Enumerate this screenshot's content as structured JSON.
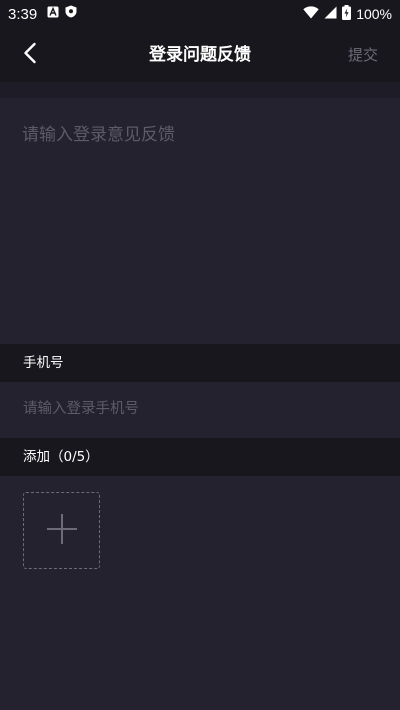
{
  "status_bar": {
    "time": "3:39",
    "left_icons": [
      "app-a-icon",
      "shield-icon"
    ],
    "battery_percent": "100%",
    "right_icons": [
      "wifi-icon",
      "signal-icon",
      "battery-charging-icon"
    ]
  },
  "nav": {
    "back_icon": "chevron-left-icon",
    "title": "登录问题反馈",
    "submit_label": "提交"
  },
  "feedback": {
    "placeholder": "请输入登录意见反馈",
    "value": ""
  },
  "phone": {
    "section_label": "手机号",
    "placeholder": "请输入登录手机号",
    "value": ""
  },
  "attachments": {
    "section_label": "添加（0/5）",
    "add_icon": "plus-icon"
  },
  "colors": {
    "background": "#24222f",
    "bar": "#18171d",
    "muted_text": "#6d6b78"
  }
}
